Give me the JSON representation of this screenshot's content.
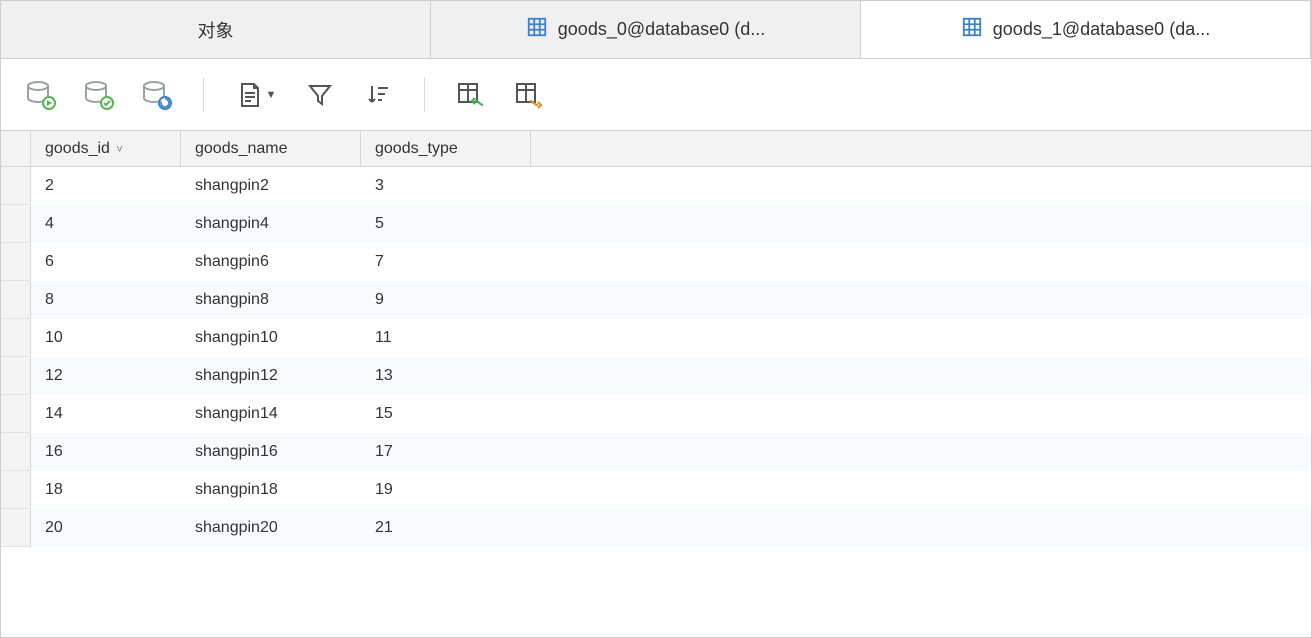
{
  "tabs": {
    "objects": "对象",
    "goods0": "goods_0@database0 (d...",
    "goods1": "goods_1@database0 (da..."
  },
  "columns": {
    "goods_id": "goods_id",
    "goods_name": "goods_name",
    "goods_type": "goods_type"
  },
  "rows": [
    {
      "goods_id": "2",
      "goods_name": "shangpin2",
      "goods_type": "3"
    },
    {
      "goods_id": "4",
      "goods_name": "shangpin4",
      "goods_type": "5"
    },
    {
      "goods_id": "6",
      "goods_name": "shangpin6",
      "goods_type": "7"
    },
    {
      "goods_id": "8",
      "goods_name": "shangpin8",
      "goods_type": "9"
    },
    {
      "goods_id": "10",
      "goods_name": "shangpin10",
      "goods_type": "11"
    },
    {
      "goods_id": "12",
      "goods_name": "shangpin12",
      "goods_type": "13"
    },
    {
      "goods_id": "14",
      "goods_name": "shangpin14",
      "goods_type": "15"
    },
    {
      "goods_id": "16",
      "goods_name": "shangpin16",
      "goods_type": "17"
    },
    {
      "goods_id": "18",
      "goods_name": "shangpin18",
      "goods_type": "19"
    },
    {
      "goods_id": "20",
      "goods_name": "shangpin20",
      "goods_type": "21"
    }
  ]
}
